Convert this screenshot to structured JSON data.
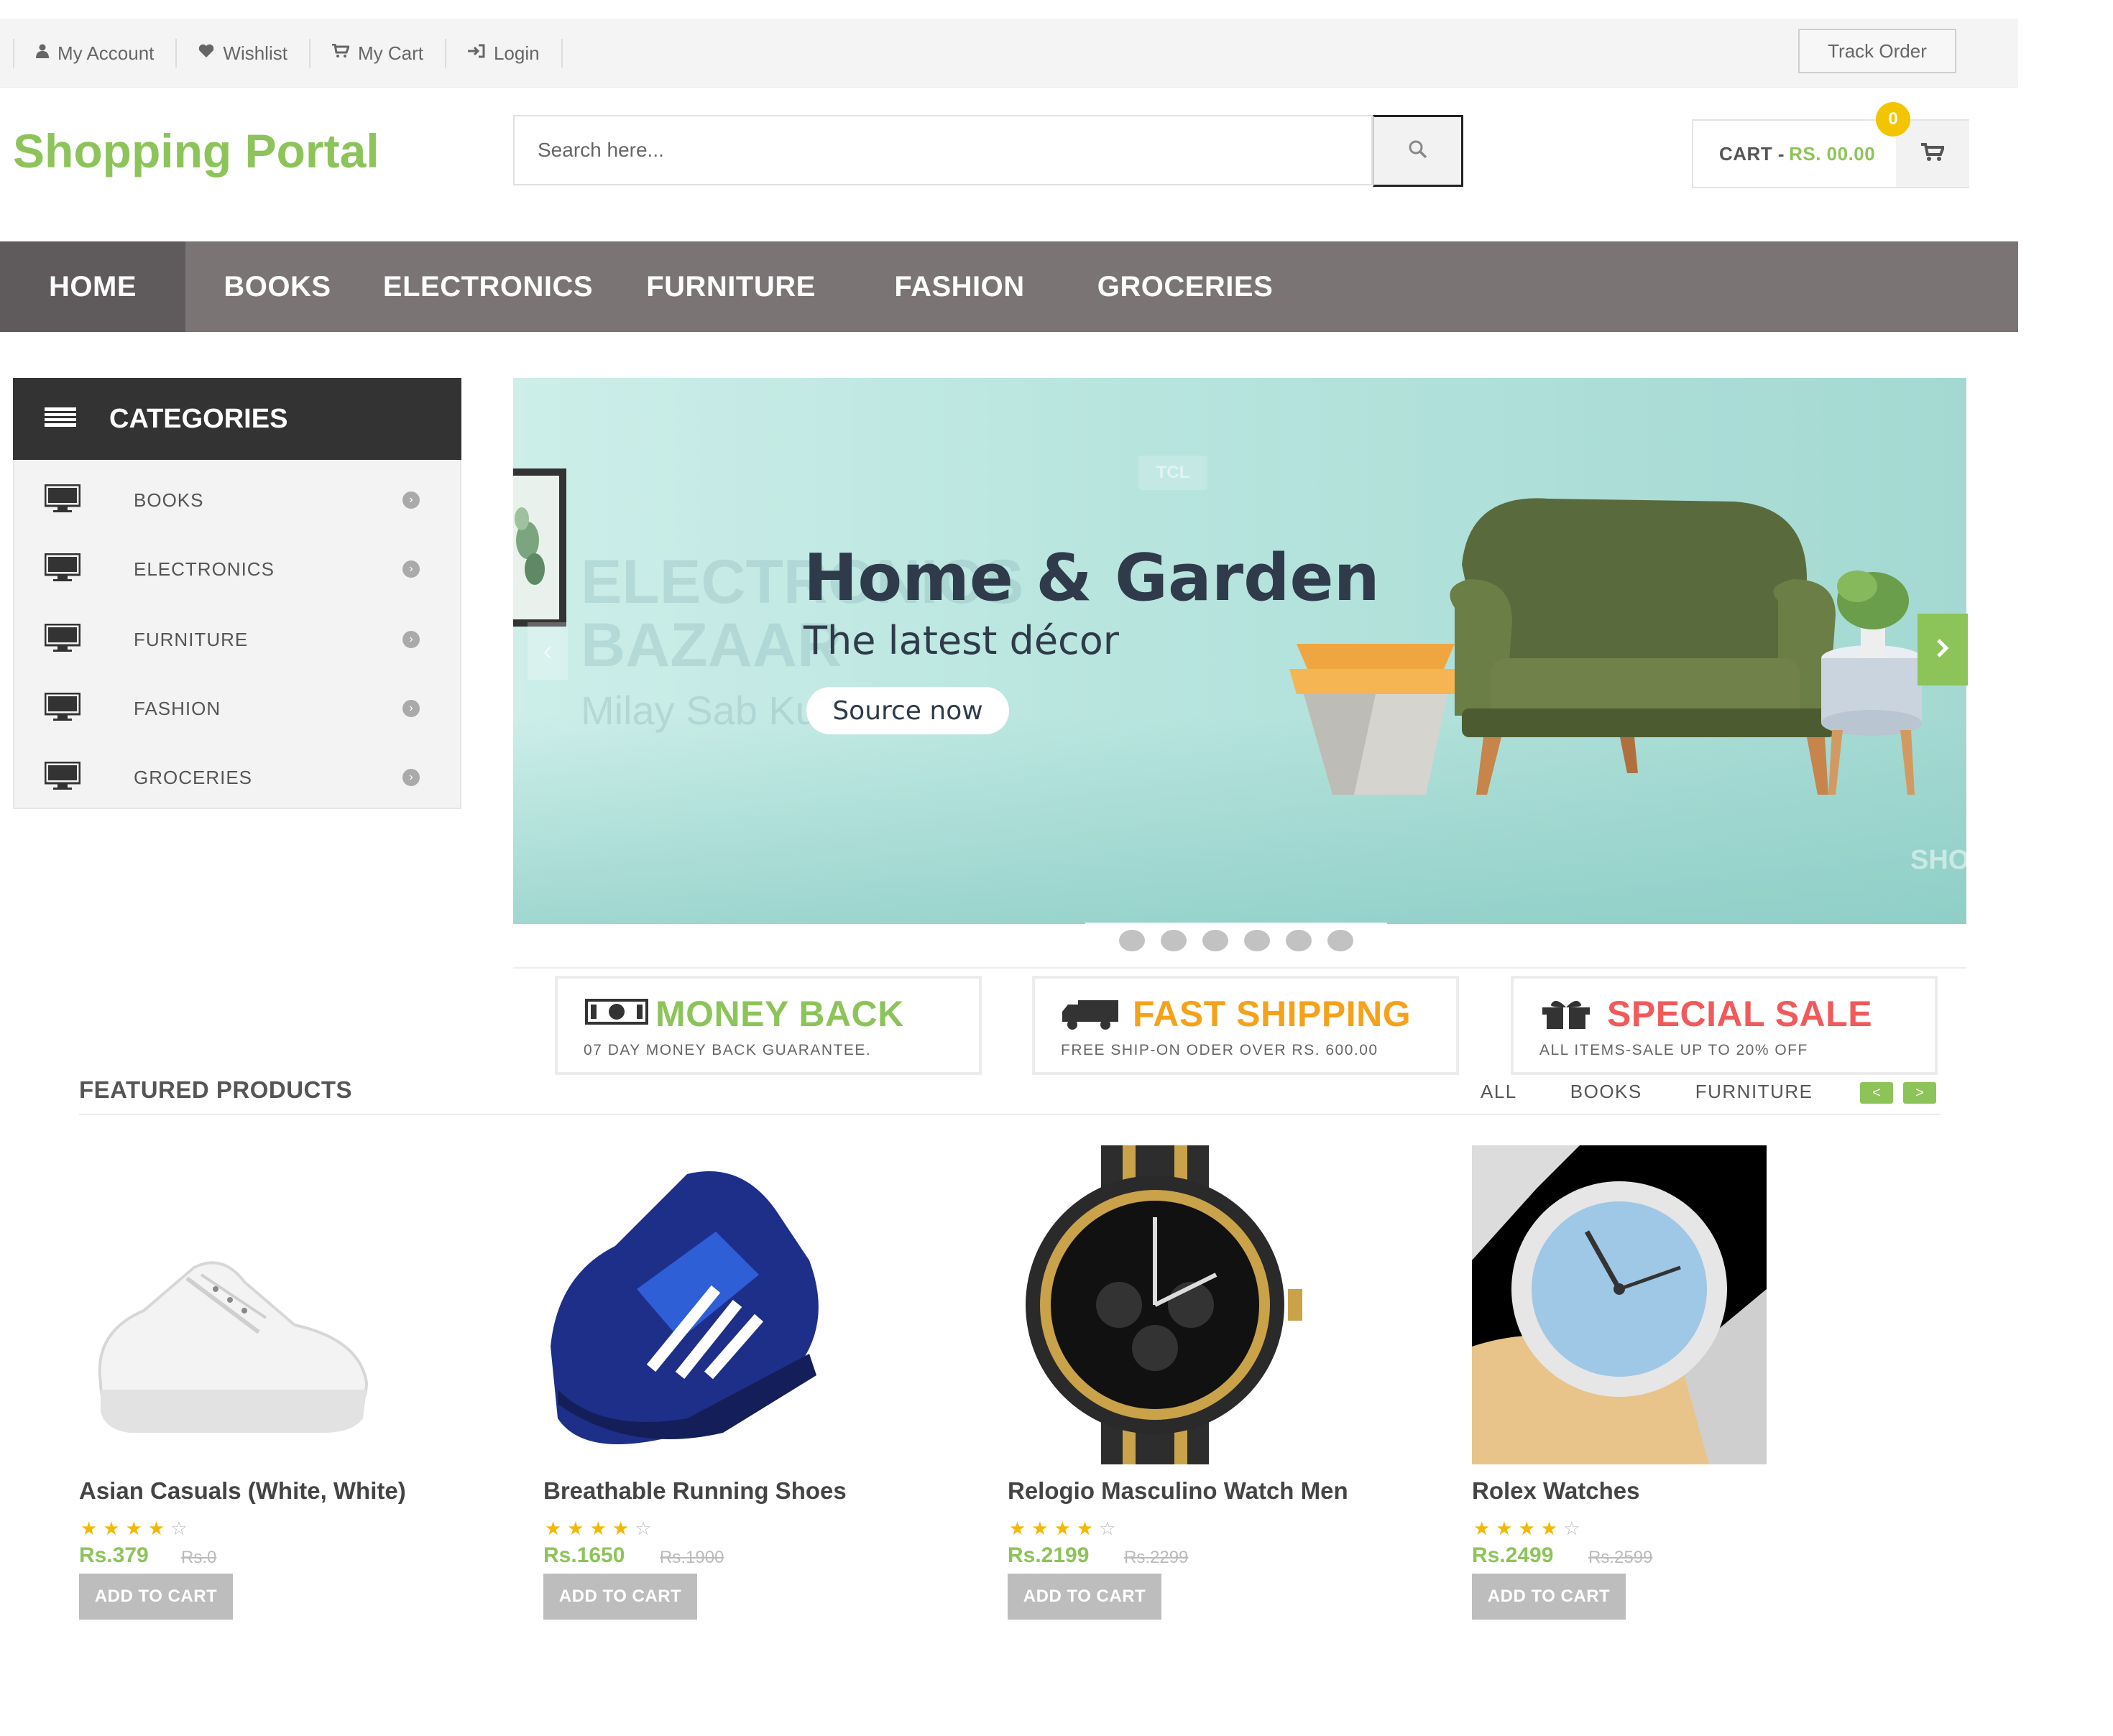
{
  "topbar": {
    "links": [
      {
        "label": "My Account",
        "icon": "user-icon"
      },
      {
        "label": "Wishlist",
        "icon": "heart-icon"
      },
      {
        "label": "My Cart",
        "icon": "cart-icon"
      },
      {
        "label": "Login",
        "icon": "sign-in-icon"
      }
    ],
    "track_order": "Track Order"
  },
  "header": {
    "logo": "Shopping Portal",
    "search_placeholder": "Search here...",
    "cart_label": "CART -",
    "cart_amount": "RS. 00.00",
    "cart_count": "0"
  },
  "nav": {
    "items": [
      "HOME",
      "BOOKS",
      "ELECTRONICS",
      "FURNITURE",
      "FASHION",
      "GROCERIES"
    ]
  },
  "categories": {
    "title": "CATEGORIES",
    "items": [
      "BOOKS",
      "ELECTRONICS",
      "FURNITURE",
      "FASHION",
      "GROCERIES"
    ]
  },
  "banner": {
    "title": "Home & Garden",
    "subtitle": "The latest décor",
    "cta": "Source now",
    "ghost_line1": "ELECTRONICS",
    "ghost_line2": "BAZAAR",
    "ghost_sub": "Milay Sab Kuch",
    "ghost_tcl": "TCL",
    "ghost_sh": "SHO",
    "slide_count": 6
  },
  "services": [
    {
      "title": "MONEY BACK",
      "sub": "07 DAY MONEY BACK GUARANTEE.",
      "color": "#8dc45a",
      "icon": "money-icon"
    },
    {
      "title": "FAST SHIPPING",
      "sub": "FREE SHIP-ON ODER OVER RS. 600.00",
      "color": "#f5a21b",
      "icon": "truck-icon"
    },
    {
      "title": "SPECIAL SALE",
      "sub": "ALL ITEMS-SALE UP TO 20% OFF",
      "color": "#f05a5a",
      "icon": "gift-icon"
    }
  ],
  "featured": {
    "title": "FEATURED PRODUCTS",
    "tabs": [
      "ALL",
      "BOOKS",
      "FURNITURE"
    ],
    "prev": "<",
    "next": ">"
  },
  "products": [
    {
      "name": "Asian Casuals (White, White)",
      "price": "Rs.379",
      "old_price": "Rs.0",
      "rating": 4,
      "button": "ADD TO CART"
    },
    {
      "name": "Breathable Running Shoes",
      "price": "Rs.1650",
      "old_price": "Rs.1900",
      "rating": 4,
      "button": "ADD TO CART"
    },
    {
      "name": "Relogio Masculino Watch Men",
      "price": "Rs.2199",
      "old_price": "Rs.2299",
      "rating": 4,
      "button": "ADD TO CART"
    },
    {
      "name": "Rolex Watches",
      "price": "Rs.2499",
      "old_price": "Rs.2599",
      "rating": 4,
      "button": "ADD TO CART"
    }
  ],
  "colors": {
    "accent": "#8dc45a",
    "nav_bg": "#7a7475",
    "nav_active": "#5f5a5b",
    "badge": "#f3c500"
  }
}
